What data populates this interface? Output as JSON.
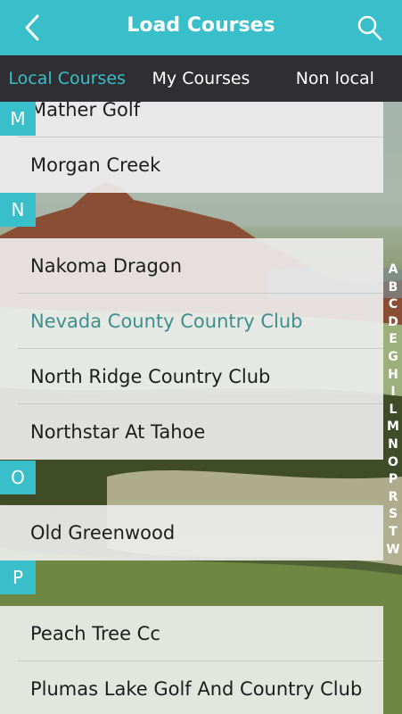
{
  "header": {
    "title": "Load Courses",
    "back_icon": "chevron-left-icon",
    "search_icon": "search-icon"
  },
  "tabs": [
    {
      "label": "Local Courses",
      "active": true
    },
    {
      "label": "My Courses",
      "active": false
    },
    {
      "label": "Non local",
      "active": false
    }
  ],
  "sections": {
    "m": {
      "letter": "M",
      "courses": [
        "Mather Golf",
        "Morgan Creek"
      ]
    },
    "n": {
      "letter": "N",
      "courses": [
        "Nakoma Dragon",
        "Nevada County Country Club",
        "North Ridge Country Club",
        "Northstar At Tahoe"
      ]
    },
    "o": {
      "letter": "O",
      "courses": [
        "Old Greenwood"
      ]
    },
    "p": {
      "letter": "P",
      "courses": [
        "Peach Tree Cc",
        "Plumas Lake Golf And Country Club"
      ]
    }
  },
  "index_letters": [
    "A",
    "B",
    "C",
    "D",
    "E",
    "G",
    "H",
    "I",
    "L",
    "M",
    "N",
    "O",
    "P",
    "R",
    "S",
    "T",
    "W"
  ],
  "colors": {
    "accent": "#38bfc9",
    "tab_bar": "#2f2f33",
    "highlight_text": "#3e8f8b"
  }
}
